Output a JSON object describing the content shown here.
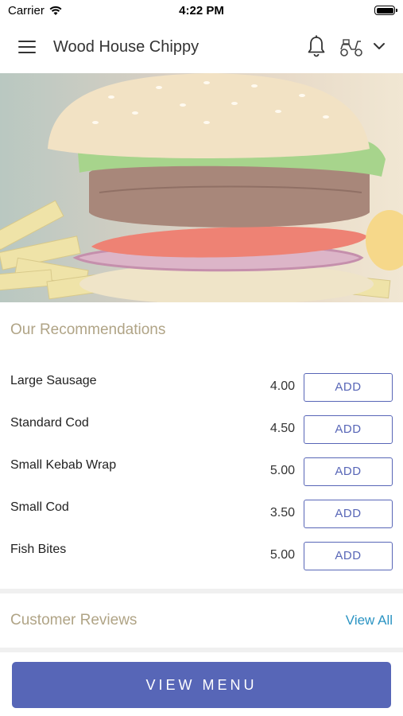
{
  "status_bar": {
    "carrier": "Carrier",
    "time": "4:22 PM"
  },
  "header": {
    "title": "Wood House Chippy"
  },
  "icons": {
    "menu": "hamburger-menu-icon",
    "notifications": "bell-icon",
    "delivery": "scooter-icon",
    "dropdown": "chevron-down-icon"
  },
  "recommendations": {
    "title": "Our Recommendations",
    "items": [
      {
        "name": "Large Sausage",
        "price": "4.00",
        "button": "ADD"
      },
      {
        "name": "Standard Cod",
        "price": "4.50",
        "button": "ADD"
      },
      {
        "name": "Small Kebab Wrap",
        "price": "5.00",
        "button": "ADD"
      },
      {
        "name": "Small Cod",
        "price": "3.50",
        "button": "ADD"
      },
      {
        "name": "Fish Bites",
        "price": "5.00",
        "button": "ADD"
      }
    ]
  },
  "reviews": {
    "title": "Customer Reviews",
    "view_all": "View All"
  },
  "footer": {
    "view_menu": "VIEW MENU"
  },
  "colors": {
    "accent": "#5766b7",
    "section_title": "#b0a486",
    "link": "#2b94c3"
  }
}
